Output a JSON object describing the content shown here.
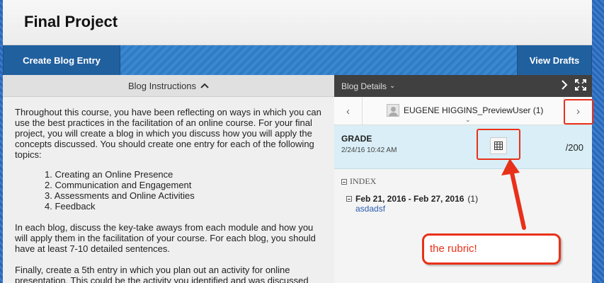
{
  "page": {
    "title": "Final Project"
  },
  "actions": {
    "create_label": "Create Blog Entry",
    "drafts_label": "View Drafts"
  },
  "instructions": {
    "header": "Blog Instructions",
    "paragraphs": [
      "Throughout this course, you have been reflecting on ways in which you can use the best practices in the facilitation of an online course.  For your final project, you will create a blog in which you discuss how you will apply the concepts discussed.  You should create one entry for each of the following topics:",
      "In each blog, discuss the key-take aways from each module and how you will apply them in the facilitation of your course.  For each blog, you should have at least 7-10 detailed sentences.",
      "Finally, create a 5th entry in which you plan out an activity for online presentation.  This could be the activity you identified and was discussed"
    ],
    "topics": [
      "1. Creating an Online Presence",
      "2. Communication and Engagement",
      "3. Assessments and Online Activities",
      "4. Feedback"
    ]
  },
  "details": {
    "header": "Blog Details",
    "user": "EUGENE HIGGINS_PreviewUser (1)",
    "grade_label": "GRADE",
    "grade_date": "2/24/16 10:42 AM",
    "grade_score": "/200",
    "index_label": "INDEX",
    "week": "Feb 21, 2016 - Feb 27, 2016",
    "week_count": "(1)",
    "entry": "asdadsf"
  },
  "annotation": {
    "text": "the rubric!",
    "color": "#e8311a"
  }
}
